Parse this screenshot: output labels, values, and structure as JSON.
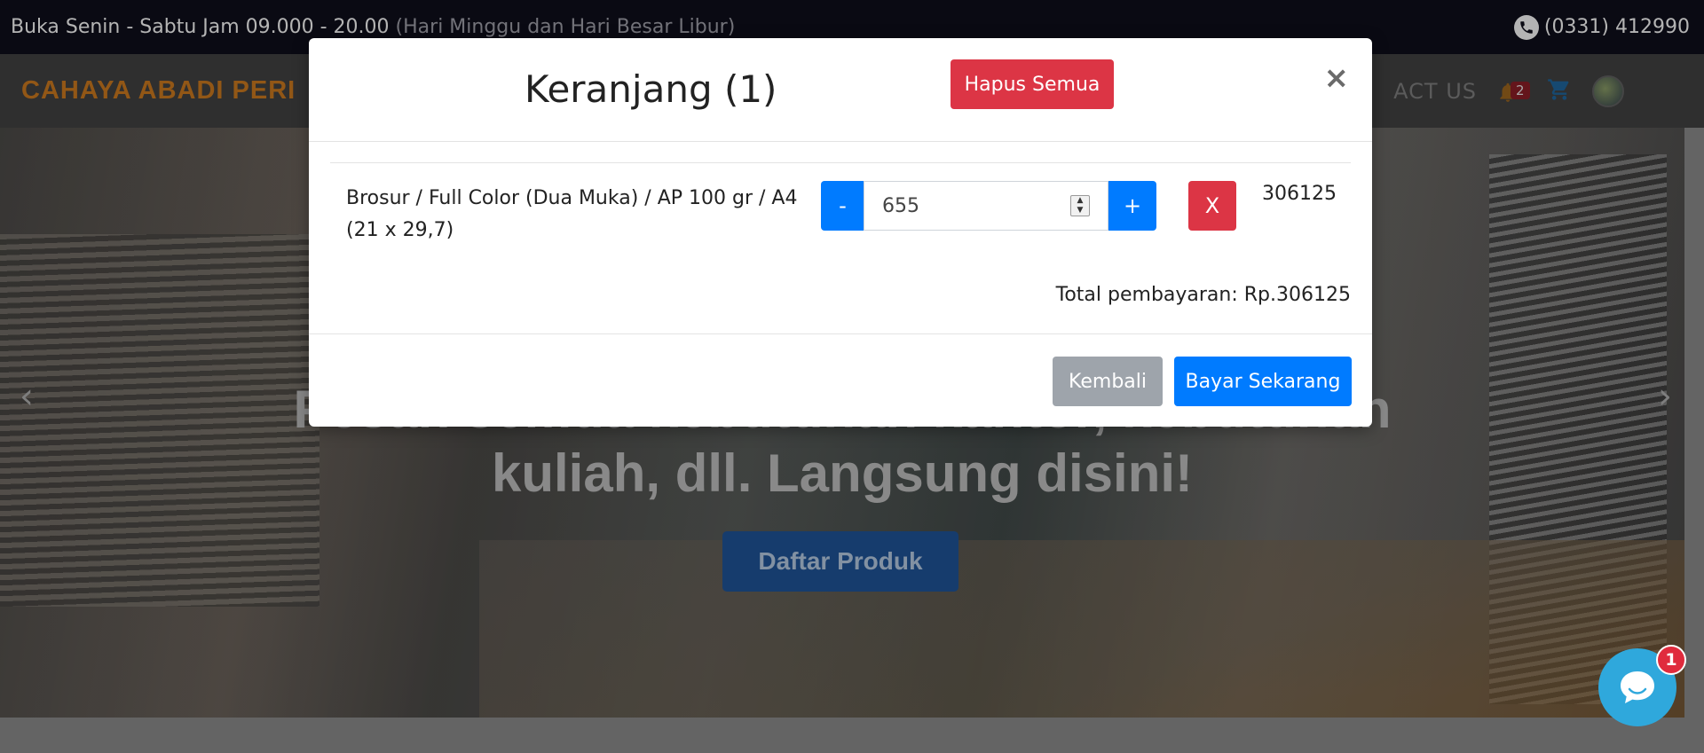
{
  "topbar": {
    "hours": "Buka Senin - Sabtu Jam 09.000 - 20.00",
    "holiday_note": "(Hari Minggu dan Hari Besar Libur)",
    "phone": "(0331) 412990",
    "phone_icon": "phone-icon"
  },
  "navbar": {
    "brand": "CAHAYA ABADI PERI",
    "contact_label": "ACT US",
    "notification_count": "2",
    "icons": [
      "bell-icon",
      "cart-icon",
      "avatar"
    ]
  },
  "hero": {
    "title_line1": "Pesan semua kebutuhan kantor, kebutuhan",
    "title_line2": "kuliah, dll. Langsung disini!",
    "button_label": "Daftar Produk",
    "prev_arrow": "‹",
    "next_arrow": "›"
  },
  "cart_modal": {
    "title": "Keranjang (1)",
    "clear_all_label": "Hapus Semua",
    "close_symbol": "×",
    "items": [
      {
        "name": "Brosur / Full Color (Dua Muka) / AP 100 gr / A4 (21 x 29,7)",
        "minus_label": "-",
        "quantity": "655",
        "plus_label": "+",
        "remove_label": "X",
        "price": "306125"
      }
    ],
    "total_text": "Total pembayaran: Rp.306125",
    "back_label": "Kembali",
    "pay_label": "Bayar Sekarang"
  },
  "chat_widget": {
    "unread_count": "1"
  },
  "colors": {
    "danger": "#dc3545",
    "primary": "#007bff",
    "secondary": "#9ea4ab",
    "brand": "#b36b1c"
  }
}
